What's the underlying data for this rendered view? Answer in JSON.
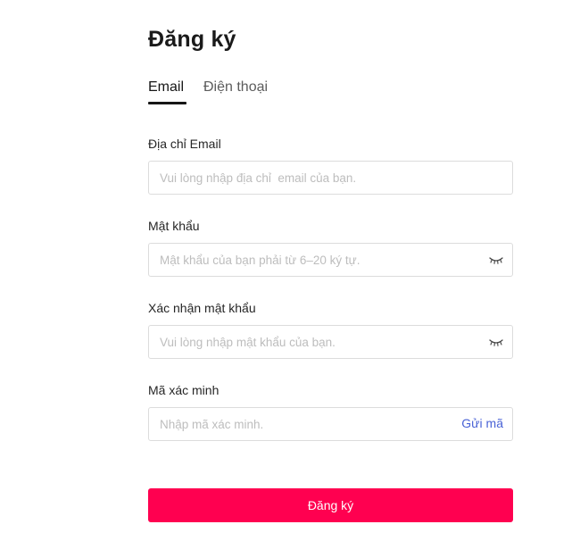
{
  "page": {
    "title": "Đăng ký"
  },
  "tabs": [
    {
      "label": "Email",
      "active": true
    },
    {
      "label": "Điện thoại",
      "active": false
    }
  ],
  "fields": {
    "email": {
      "label": "Địa chỉ Email",
      "placeholder": "Vui lòng nhập địa chỉ  email của bạn.",
      "value": ""
    },
    "password": {
      "label": "Mật khẩu",
      "placeholder": "Mật khẩu của bạn phải từ 6–20 ký tự.",
      "value": "",
      "icon": "eye-closed-icon"
    },
    "confirm_password": {
      "label": "Xác nhận mật khẩu",
      "placeholder": "Vui lòng nhập mật khẩu của bạn.",
      "value": "",
      "icon": "eye-closed-icon"
    },
    "verification_code": {
      "label": "Mã xác minh",
      "placeholder": "Nhập mã xác minh.",
      "value": "",
      "send_code_label": "Gửi mã"
    }
  },
  "submit": {
    "label": "Đăng ký"
  },
  "colors": {
    "primary": "#ff0050",
    "link": "#4a63d6",
    "border": "#dcdcdc",
    "placeholder": "#bdbdbd"
  }
}
